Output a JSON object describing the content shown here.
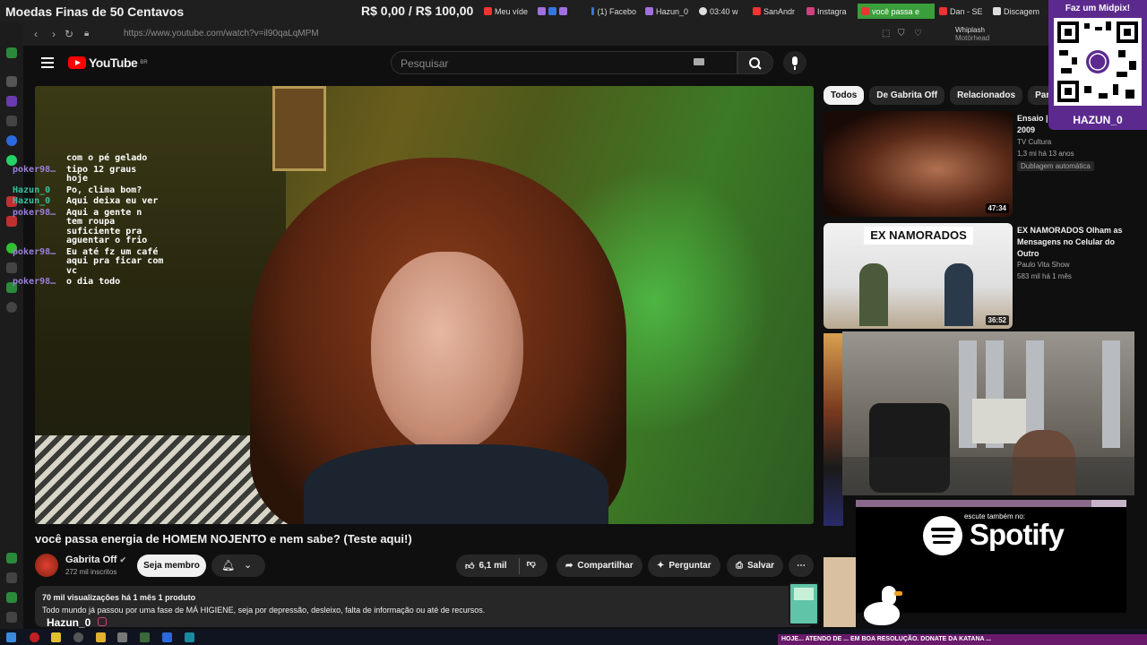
{
  "overlay_top": {
    "goal_title": "Moedas Finas de 50 Centavos",
    "goal_amount": "R$ 0,00 / R$ 100,00",
    "tabs": [
      {
        "label": "Meu víde",
        "color": "#e33"
      },
      {
        "label": "",
        "color": "#a070e0"
      },
      {
        "label": "(1) Facebo",
        "color": "#3b74e0"
      },
      {
        "label": "Hazun_0",
        "color": "#a070e0"
      },
      {
        "label": "03:40 w",
        "color": "#ddd"
      },
      {
        "label": "SanAndr",
        "color": "#e33"
      },
      {
        "label": "Instagra",
        "color": "#d04080"
      },
      {
        "label": "você passa e",
        "color": "#e33",
        "active": true
      },
      {
        "label": "Dan - SE",
        "color": "#e33"
      },
      {
        "label": "Discagem",
        "color": "#ddd"
      }
    ]
  },
  "browser": {
    "url": "https://www.youtube.com/watch?v=il90qaLqMPM",
    "now_playing_title": "Whiplash",
    "now_playing_artist": "Motörhead"
  },
  "youtube": {
    "logo_text": "YouTube",
    "region": "BR",
    "search_placeholder": "Pesquisar"
  },
  "stream_chat": [
    {
      "user": "",
      "message": "com o pé gelado"
    },
    {
      "user": "poker98…",
      "message": "tipo 12 graus\nhoje"
    },
    {
      "user": "Hazun_0",
      "message": "Po, clima bom?"
    },
    {
      "user": "Hazun_0",
      "message": "Aqui deixa eu ver"
    },
    {
      "user": "poker98…",
      "message": "Aqui a gente n\ntem roupa\nsuficiente pra\naguentar o frio"
    },
    {
      "user": "poker98…",
      "message": "Eu até fz um café\naqui pra ficar com\nvc"
    },
    {
      "user": "poker98…",
      "message": "o dia todo"
    }
  ],
  "video": {
    "title": "você passa energia de HOMEM NOJENTO e nem sabe? (Teste aqui!)",
    "channel": "Gabrita Off",
    "subscribers": "272 mil inscritos",
    "join_label": "Seja membro",
    "likes": "6,1 mil",
    "share_label": "Compartilhar",
    "ask_label": "Perguntar",
    "save_label": "Salvar",
    "views_meta": "70 mil visualizações  há 1 mês  1 produto",
    "description": "Todo mundo já passou por uma fase de MÁ HIGIENE, seja por depressão, desleixo, falta de informação ou até de recursos."
  },
  "chips": [
    "Todos",
    "De Gabrita Off",
    "Relacionados",
    "Para você"
  ],
  "recommendations": [
    {
      "title": "Ensaio | C\n2009",
      "channel": "TV Cultura",
      "meta": "1,3 mi  há 13 anos",
      "badge": "Dublagem automática",
      "duration": "47:34"
    },
    {
      "title": "EX NAMORADOS Olham as Mensagens no Celular do Outro",
      "channel": "Paulo Vita Show",
      "meta": "583 mil  há 1 mês",
      "badge": "",
      "duration": "36:52",
      "thumb_caption": "EX NAMORADOS"
    }
  ],
  "overlays": {
    "qr_title": "Faz um Midpix!",
    "streamer_name": "HAZUN_0",
    "spotify_sub": "escute também no:",
    "spotify_word": "Spotify",
    "ticker": "HOJE... ATENDO DE ... EM BOA RESOLUÇÃO. DONATE DA KATANA ...",
    "bottom_handle": "Hazun_0",
    "progress_fraction": 0.87
  }
}
